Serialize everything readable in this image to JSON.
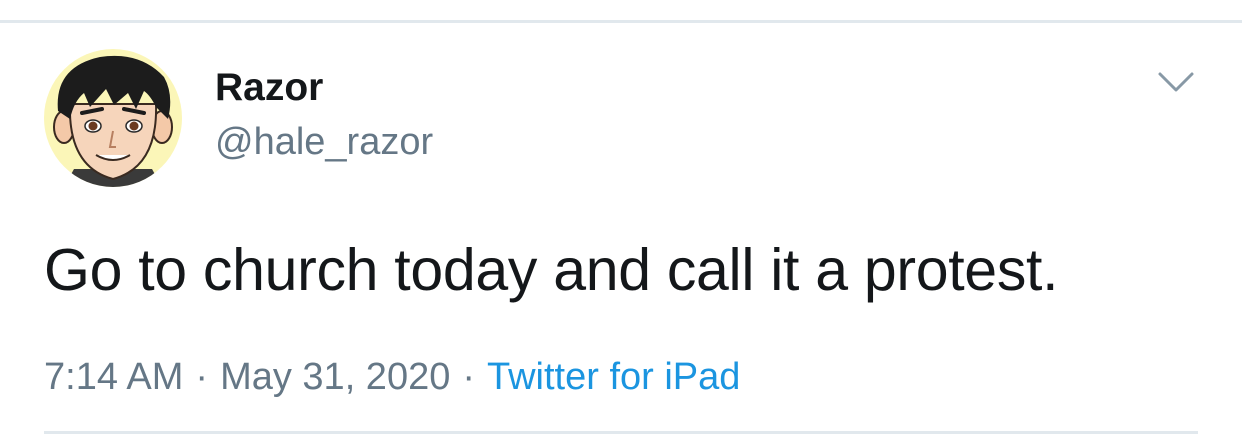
{
  "author": {
    "display_name": "Razor",
    "handle": "@hale_razor",
    "avatar_icon": "cartoon-face-avatar"
  },
  "tweet": {
    "text": "Go to church today and call it a protest."
  },
  "meta": {
    "time": "7:14 AM",
    "separator": "·",
    "date": "May 31, 2020",
    "source": "Twitter for iPad"
  },
  "icons": {
    "menu": "chevron-down-icon"
  },
  "colors": {
    "primary_text": "#14171a",
    "secondary_text": "#657786",
    "link": "#1b95e0",
    "divider": "#e1e8ed",
    "avatar_background": "#fbf6b8"
  }
}
